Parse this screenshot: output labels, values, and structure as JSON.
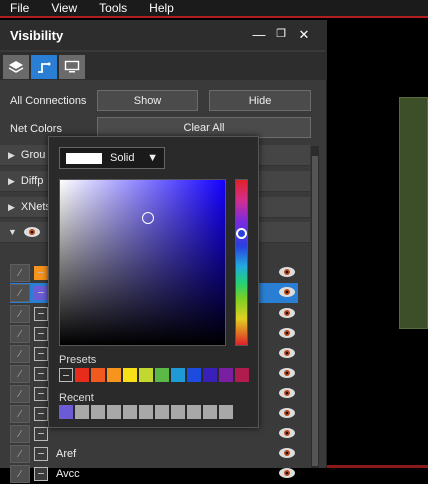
{
  "menu": [
    "File",
    "View",
    "Tools",
    "Help"
  ],
  "panel": {
    "title": "Visibility",
    "all_connections_label": "All Connections",
    "show_label": "Show",
    "hide_label": "Hide",
    "net_colors_label": "Net Colors",
    "clear_all_label": "Clear All",
    "groups": [
      "Grou",
      "Diffp",
      "XNets"
    ],
    "nets": [
      "",
      "",
      "",
      "",
      "",
      "",
      "",
      "",
      "",
      "Aref",
      "Avcc"
    ]
  },
  "picker": {
    "fill_mode": "Solid",
    "presets_label": "Presets",
    "recent_label": "Recent",
    "accent": "#1400ff",
    "presets": [
      "#e82c1c",
      "#f05a1e",
      "#f7941d",
      "#f7e018",
      "#c3d82e",
      "#5ab947",
      "#1f9ad6",
      "#1d4be0",
      "#3a1fb8",
      "#7b1fa2",
      "#b01c4e"
    ],
    "recent": [
      "#6b5cd6",
      "#a8a8a8",
      "#a8a8a8",
      "#a8a8a8",
      "#a8a8a8",
      "#a8a8a8",
      "#a8a8a8",
      "#a8a8a8",
      "#a8a8a8",
      "#a8a8a8",
      "#a8a8a8"
    ]
  },
  "colors": {
    "selection": "#2a7fd4",
    "menu_border": "#b01e1e"
  }
}
